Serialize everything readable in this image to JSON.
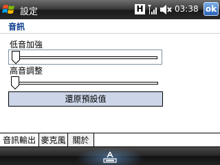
{
  "window": {
    "title": "設定",
    "clock": "03:38",
    "ok_label": "ok",
    "h_badge": "H",
    "icons": [
      "windows-start-icon",
      "h-badge-icon",
      "signal-strength-icon",
      "speaker-muted-icon",
      "keyboard-icon"
    ]
  },
  "section": {
    "title": "音訊"
  },
  "bass": {
    "label": "低音加強",
    "level": 0
  },
  "treble": {
    "label": "高音調整",
    "level": 0
  },
  "reset_button_label": "還原預設值",
  "tabs": [
    {
      "label": "音訊輸出",
      "active": true
    },
    {
      "label": "麥克風",
      "active": false
    },
    {
      "label": "關於",
      "active": false
    }
  ],
  "colors": {
    "section_title": "#0b3a8c",
    "button_fill": "#ccd6e8",
    "ok_button": "#2a63b8"
  }
}
